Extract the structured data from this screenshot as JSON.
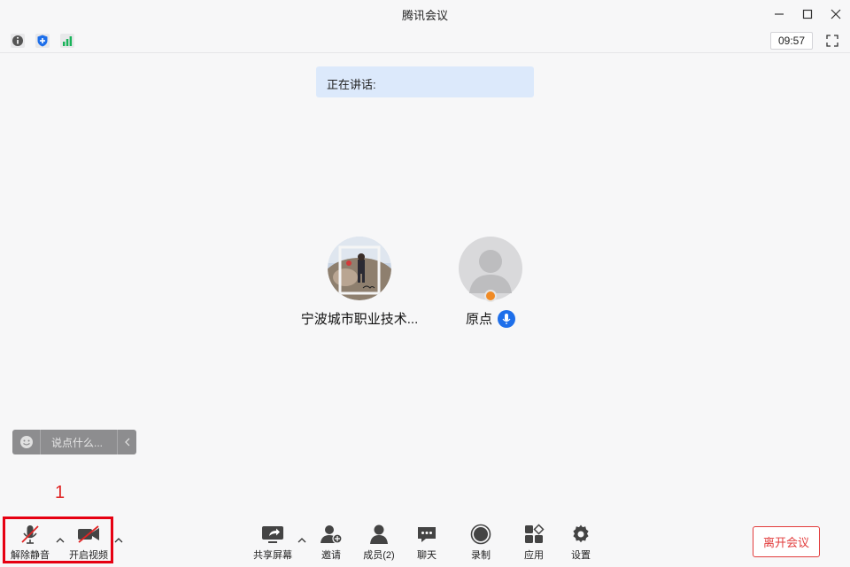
{
  "window": {
    "title": "腾讯会议"
  },
  "status": {
    "clock": "09:57"
  },
  "speaking": {
    "label": "正在讲话:"
  },
  "participants": [
    {
      "name": "宁波城市职业技术..."
    },
    {
      "name": "原点"
    }
  ],
  "chat": {
    "placeholder": "说点什么..."
  },
  "annotation": {
    "number": "1"
  },
  "toolbar": {
    "unmute": "解除静音",
    "start_video": "开启视频",
    "share_screen": "共享屏幕",
    "invite": "邀请",
    "members": "成员(2)",
    "chat": "聊天",
    "record": "录制",
    "apps": "应用",
    "settings": "设置",
    "leave": "离开会议"
  },
  "colors": {
    "accent": "#1e6fea",
    "danger": "#e23c3c",
    "highlight": "#e60012",
    "speaking_bg": "#dce9fb"
  }
}
